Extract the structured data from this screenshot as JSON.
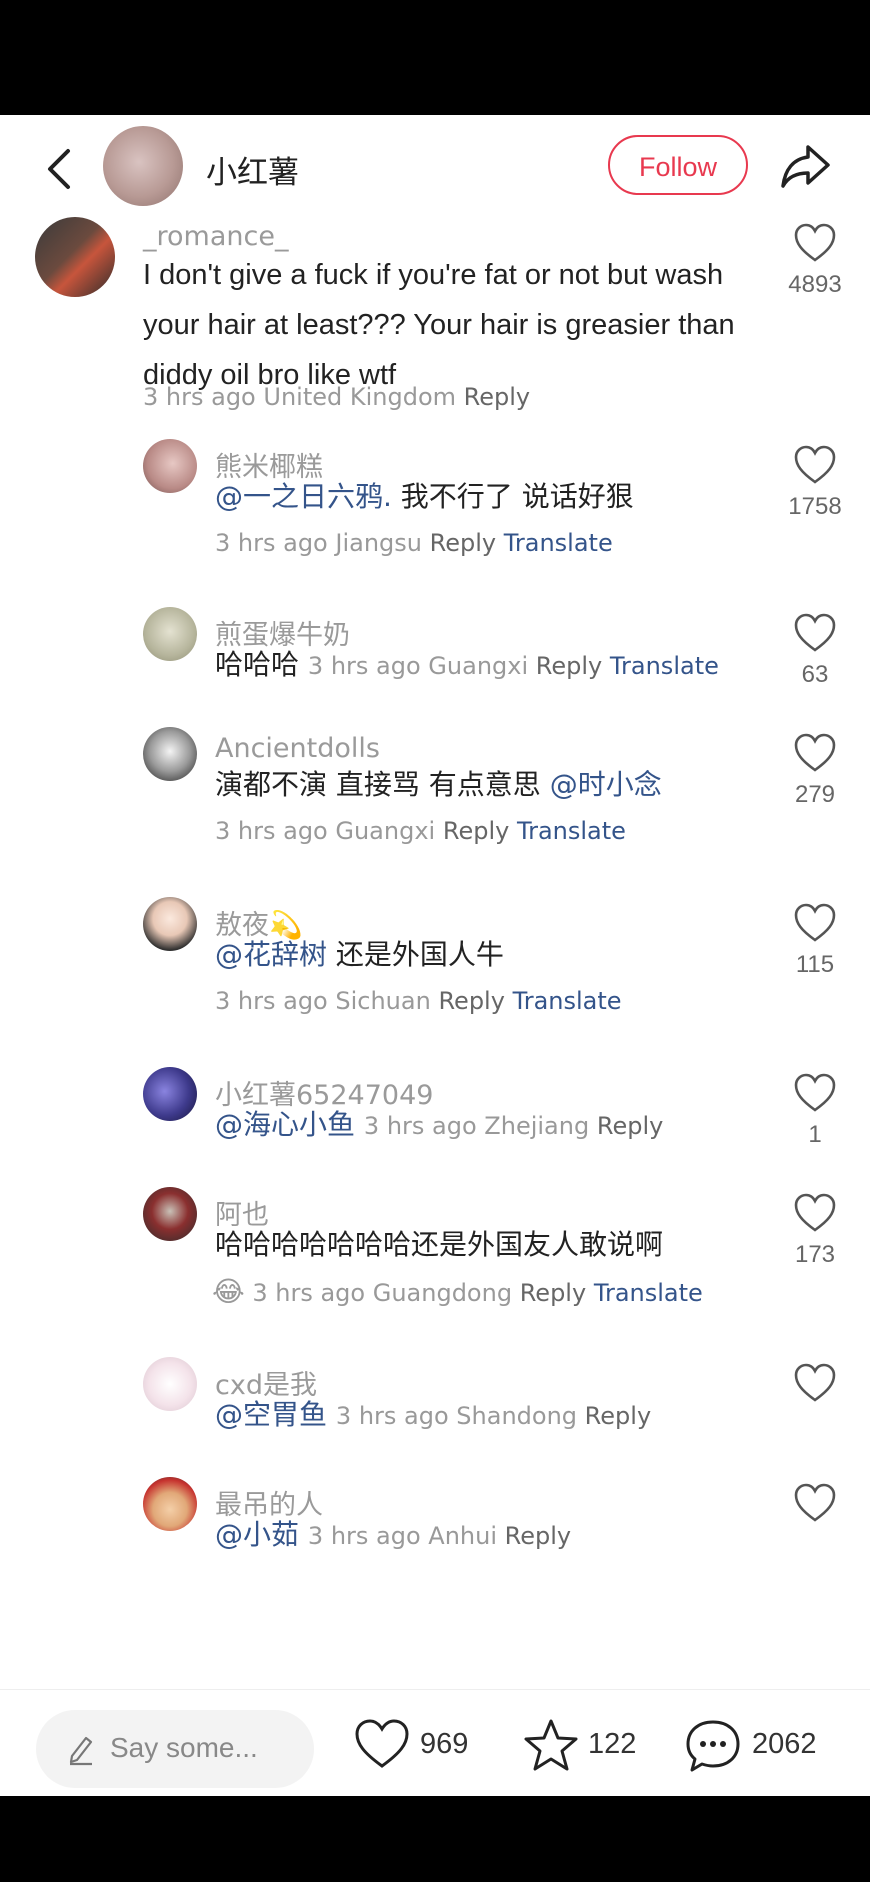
{
  "header": {
    "back_icon": "back-arrow-icon",
    "name": "小红薯",
    "follow_label": "Follow",
    "share_icon": "share-icon"
  },
  "main_comment": {
    "user": "_romance_",
    "text": "I don't give a fuck if you're fat or not but wash your hair at least???  Your hair is greasier than diddy oil bro like wtf",
    "time": "3 hrs ago",
    "location": "United Kingdom",
    "reply_label": "Reply",
    "likes": "4893"
  },
  "replies": [
    {
      "user": "熊米椰糕",
      "mention": "@一之日六鸦.",
      "text": " 我不行了 说话好狠",
      "time": "3 hrs ago",
      "location": "Jiangsu",
      "reply_label": "Reply",
      "translate_label": "Translate",
      "likes": "1758"
    },
    {
      "user": "煎蛋爆牛奶",
      "text": "哈哈哈",
      "time": "3 hrs ago",
      "location": "Guangxi",
      "reply_label": "Reply",
      "translate_label": "Translate",
      "likes": "63"
    },
    {
      "user": "Ancientdolls",
      "text": "演都不演 直接骂 有点意思 ",
      "mention": "@时小念",
      "time": "3 hrs ago",
      "location": "Guangxi",
      "reply_label": "Reply",
      "translate_label": "Translate",
      "likes": "279"
    },
    {
      "user": "敖夜",
      "user_emoji": "💫",
      "mention": "@花辞树",
      "text": " 还是外国人牛",
      "time": "3 hrs ago",
      "location": "Sichuan",
      "reply_label": "Reply",
      "translate_label": "Translate",
      "likes": "115"
    },
    {
      "user": "小红薯65247049",
      "mention": "@海心小鱼",
      "time": "3 hrs ago",
      "location": "Zhejiang",
      "reply_label": "Reply",
      "likes": "1"
    },
    {
      "user": "阿也",
      "text": "哈哈哈哈哈哈哈还是外国友人敢说啊",
      "emoji": "😂",
      "time": "3 hrs ago",
      "location": "Guangdong",
      "reply_label": "Reply",
      "translate_label": "Translate",
      "likes": "173"
    },
    {
      "user": "cxd是我",
      "mention": "@空胃鱼",
      "time": "3 hrs ago",
      "location": "Shandong",
      "reply_label": "Reply"
    },
    {
      "user": "最吊的人",
      "mention": "@小茹",
      "time": "3 hrs ago",
      "location": "Anhui",
      "reply_label": "Reply"
    }
  ],
  "bottom_bar": {
    "input_placeholder": "Say some...",
    "likes": "969",
    "stars": "122",
    "comments": "2062",
    "icons": [
      "pencil-icon",
      "heart-icon",
      "star-icon",
      "comment-bubble-icon"
    ]
  },
  "colors": {
    "accent": "#e8394f",
    "link": "#34548a",
    "muted": "#999999"
  }
}
